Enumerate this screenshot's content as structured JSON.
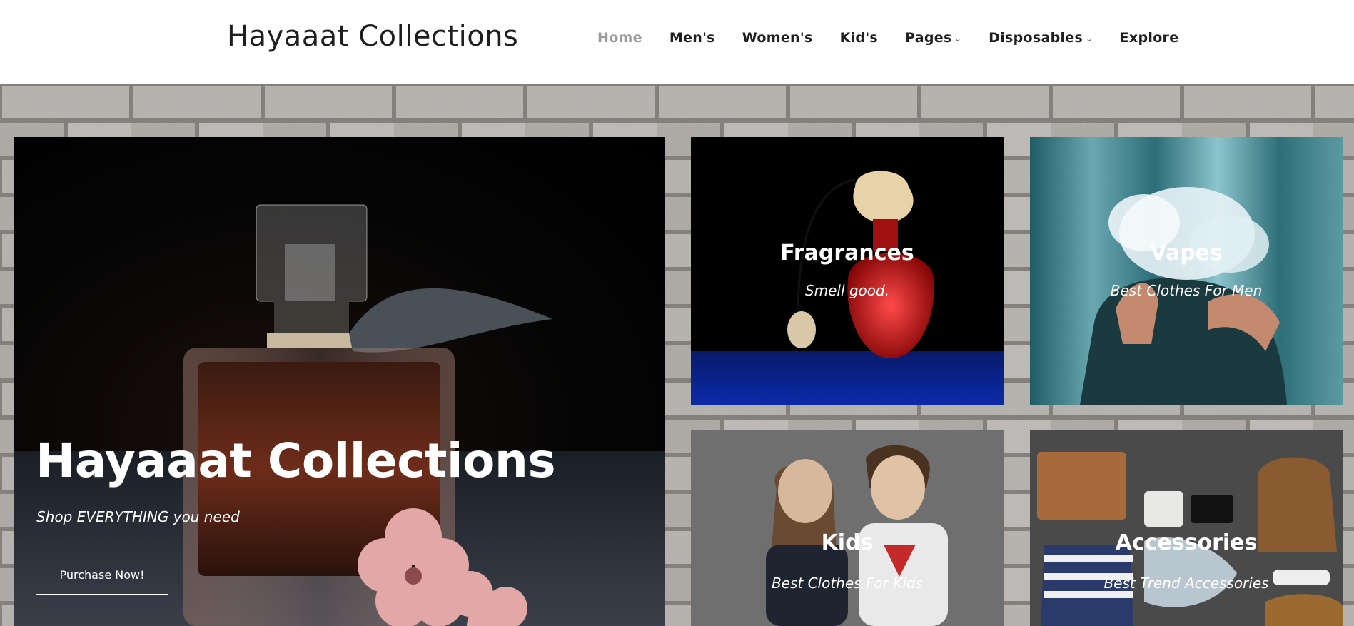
{
  "header": {
    "logo": "Hayaaat Collections",
    "nav": [
      {
        "label": "Home",
        "active": true
      },
      {
        "label": "Men's"
      },
      {
        "label": "Women's"
      },
      {
        "label": "Kid's"
      },
      {
        "label": "Pages",
        "dropdown": true
      },
      {
        "label": "Disposables",
        "dropdown": true
      },
      {
        "label": "Explore"
      }
    ]
  },
  "hero": {
    "title": "Hayaaat Collections",
    "subtitle": "Shop EVERYTHING you need",
    "button": "Purchase Now!"
  },
  "tiles": {
    "fragrances": {
      "title": "Fragrances",
      "subtitle": "Smell good."
    },
    "vapes": {
      "title": "Vapes",
      "subtitle": "Best Clothes For Men"
    },
    "kids": {
      "title": "Kids",
      "subtitle": "Best Clothes For Kids"
    },
    "accessories": {
      "title": "Accessories",
      "subtitle": "Best Trend Accessories"
    }
  },
  "icons": {
    "dropdown": "chevron-down-icon"
  },
  "colors": {
    "nav_active": "#9a9a9a",
    "text": "#1f1f1f"
  }
}
